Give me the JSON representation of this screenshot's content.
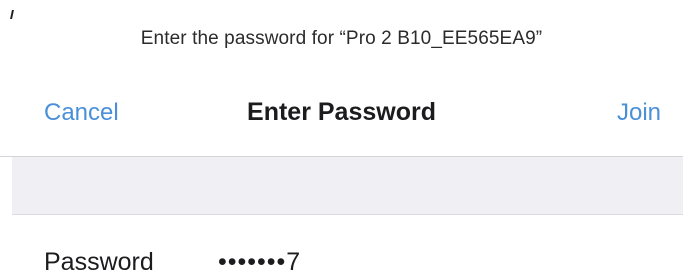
{
  "dialog": {
    "prompt": "Enter the password for “Pro 2 B10_EE565EA9”",
    "nav": {
      "cancel_label": "Cancel",
      "title": "Enter Password",
      "join_label": "Join"
    },
    "password_field": {
      "label": "Password",
      "value": "•••••••7"
    }
  },
  "colors": {
    "accent": "#4a90d9",
    "text": "#1c1c1e",
    "separator_band": "#efeff4",
    "background": "#ffffff"
  }
}
